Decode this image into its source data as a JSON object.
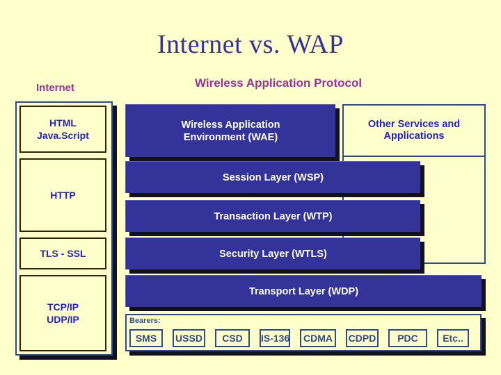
{
  "slide": {
    "title": "Internet vs. WAP",
    "background_color": "#ffffcc",
    "title_color": "#333399",
    "heading_color": "#993399",
    "layer_fill_color": "#333399",
    "layer_text_color": "#ffffff",
    "outline_color": "#2b4a8b",
    "internet_text_color": "#2222cc"
  },
  "headings": {
    "internet": "Internet",
    "wap": "Wireless Application Protocol"
  },
  "internet_stack": {
    "boxes": [
      {
        "label": "HTML\nJava.Script"
      },
      {
        "label": "HTTP"
      },
      {
        "label": "TLS - SSL"
      },
      {
        "label": "TCP/IP\nUDP/IP"
      }
    ]
  },
  "wap_stack": {
    "layers": [
      {
        "id": "wae",
        "label": "Wireless Application\nEnvironment (WAE)"
      },
      {
        "id": "wsp",
        "label": "Session Layer (WSP)"
      },
      {
        "id": "wtp",
        "label": "Transaction Layer (WTP)"
      },
      {
        "id": "wtls",
        "label": "Security Layer (WTLS)"
      },
      {
        "id": "wdp",
        "label": "Transport Layer (WDP)"
      }
    ]
  },
  "other_services": {
    "label": "Other Services and\nApplications"
  },
  "bearers": {
    "label": "Bearers:",
    "items": [
      {
        "label": "SMS"
      },
      {
        "label": "USSD"
      },
      {
        "label": "CSD"
      },
      {
        "label": "IS-136"
      },
      {
        "label": "CDMA"
      },
      {
        "label": "CDPD"
      },
      {
        "label": "PDC"
      },
      {
        "label": "Etc.."
      }
    ]
  }
}
